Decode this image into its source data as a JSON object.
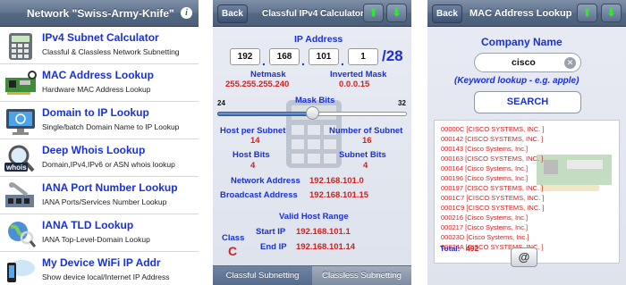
{
  "panel1": {
    "title": "Network \"Swiss-Army-Knife\"",
    "items": [
      {
        "title": "IPv4 Subnet Calculator",
        "subtitle": "Classful & Classless Network Subnetting",
        "icon": "calculator-icon"
      },
      {
        "title": "MAC Address Lookup",
        "subtitle": "Hardware MAC Address Lookup",
        "icon": "network-card-icon"
      },
      {
        "title": "Domain to IP Lookup",
        "subtitle": "Single/batch Domain Name to IP Lookup",
        "icon": "domain-monitor-icon"
      },
      {
        "title": "Deep Whois Lookup",
        "subtitle": "Domain,IPv4,IPv6 or ASN whois lookup",
        "icon": "whois-magnifier-icon"
      },
      {
        "title": "IANA Port Number Lookup",
        "subtitle": "IANA Ports/Services Number Lookup",
        "icon": "ports-wrench-icon"
      },
      {
        "title": "IANA TLD Lookup",
        "subtitle": "IANA Top-Level-Domain Lookup",
        "icon": "globe-search-icon"
      },
      {
        "title": "My Device WiFi IP Addr",
        "subtitle": "Show device local/Internet IP Address",
        "icon": "device-cloud-icon"
      }
    ]
  },
  "panel2": {
    "back": "Back",
    "title": "Classful IPv4 Calculator",
    "ip_label": "IP Address",
    "octets": [
      "192",
      "168",
      "101",
      "1"
    ],
    "prefix": "/28",
    "netmask_label": "Netmask",
    "netmask_value": "255.255.255.240",
    "inverted_label": "Inverted Mask",
    "inverted_value": "0.0.0.15",
    "maskbits_label": "Mask Bits",
    "slider_min": "24",
    "slider_max": "32",
    "slider_fraction": 0.5,
    "hosts_label": "Host per Subnet",
    "hosts_value": "14",
    "subnets_label": "Number of Subnet",
    "subnets_value": "16",
    "hostbits_label": "Host Bits",
    "hostbits_value": "4",
    "subnetbits_label": "Subnet Bits",
    "subnetbits_value": "4",
    "network_label": "Network Address",
    "network_value": "192.168.101.0",
    "broadcast_label": "Broadcast Address",
    "broadcast_value": "192.168.101.15",
    "range_label": "Valid Host Range",
    "class_label": "Class",
    "class_value": "C",
    "start_label": "Start IP",
    "start_value": "192.168.101.1",
    "end_label": "End IP",
    "end_value": "192.168.101.14",
    "tabs": [
      "Classful Subnetting",
      "Classless Subnetting"
    ]
  },
  "panel3": {
    "back": "Back",
    "title": "MAC Address Lookup",
    "company_label": "Company Name",
    "search_value": "cisco",
    "hint": "(Keyword lookup - e.g. apple)",
    "search_button": "SEARCH",
    "results": [
      "00000C [CISCO SYSTEMS, INC. ]",
      "000142 [CISCO SYSTEMS, INC. ]",
      "000143 [Cisco Systems, Inc.]",
      "000163 [CISCO SYSTEMS, INC. ]",
      "000164 [Cisco Systems, Inc.]",
      "000196 [Cisco Systems, Inc.]",
      "000197 [CISCO SYSTEMS, INC. ]",
      "0001C7 [CISCO SYSTEMS, INC. ]",
      "0001C9 [CISCO SYSTEMS, INC. ]",
      "000216 [Cisco Systems, Inc.]",
      "000217 [Cisco Systems, Inc.]",
      "00023D [Cisco Systems, Inc.]",
      "00024A [CISCO SYSTEMS, INC. ]"
    ],
    "total_label": "Total:",
    "total_value": "492"
  },
  "colors": {
    "accent_blue": "#1a31d6",
    "value_red": "#d32020",
    "navbar": "#5b6f8b"
  }
}
